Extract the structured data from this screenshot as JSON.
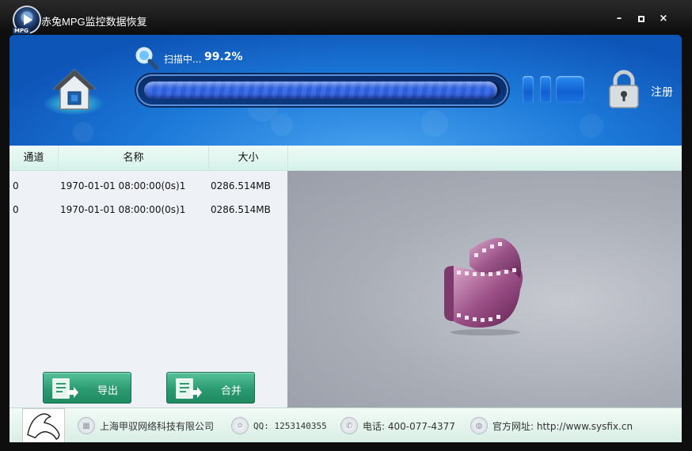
{
  "window": {
    "title": "赤兔MPG监控数据恢复",
    "logo_tag": "MPG",
    "controls": {
      "minimize": "–",
      "close": "×"
    }
  },
  "scan": {
    "label": "扫描中...",
    "percent_text": "99.2%",
    "progress": 0.992
  },
  "header": {
    "register_label": "注册"
  },
  "table": {
    "columns": [
      "通道",
      "名称",
      "大小"
    ],
    "rows": [
      {
        "channel": "0",
        "name": "1970-01-01 08:00:00(0s)1",
        "size": "0286.514MB"
      },
      {
        "channel": "0",
        "name": "1970-01-01 08:00:00(0s)1",
        "size": "0286.514MB"
      }
    ]
  },
  "actions": {
    "export_label": "导出",
    "merge_label": "合并"
  },
  "footer": {
    "company": "上海甲驭网络科技有限公司",
    "qq": "QQ: 1253140355",
    "phone": "电话: 400-077-4377",
    "website": "官方网址: http://www.sysfix.cn"
  },
  "colors": {
    "header_blue": "#1c79d8",
    "button_green": "#2c9b72",
    "progress_fill": "#2f5fd8"
  }
}
